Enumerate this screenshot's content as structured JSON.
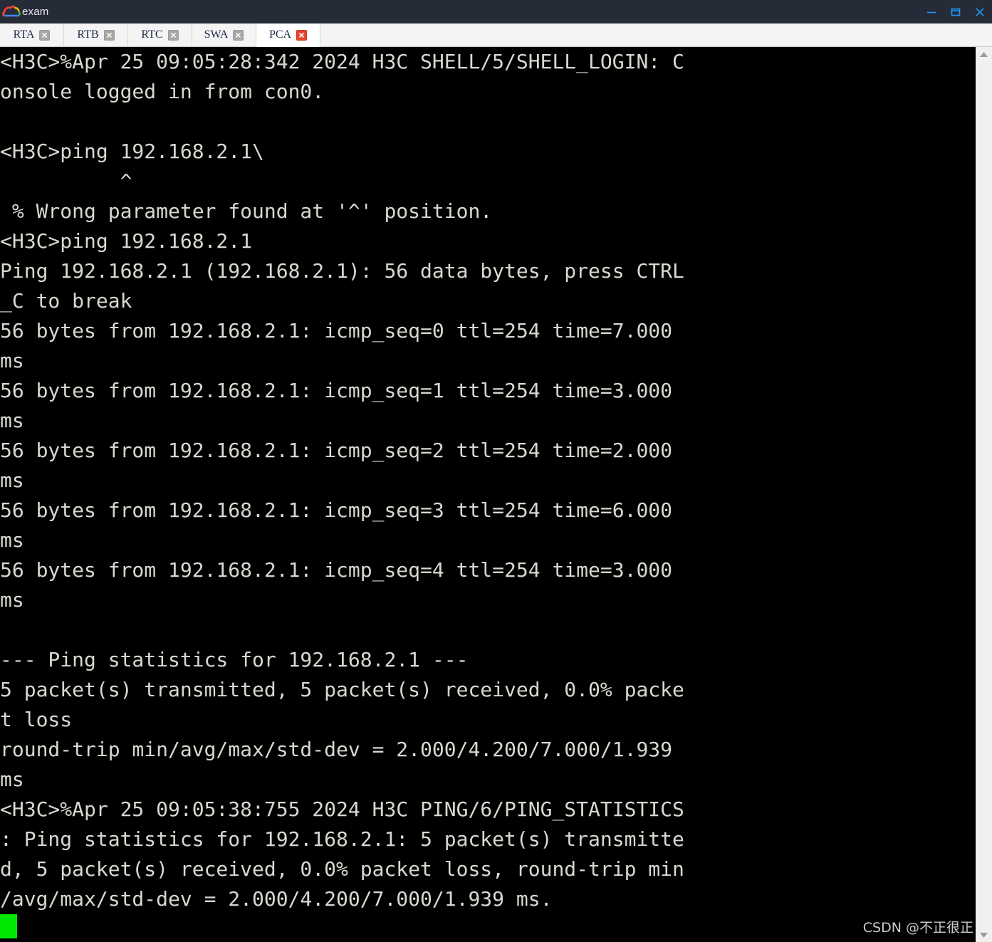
{
  "window": {
    "title": "exam",
    "logo_icon": "cloud-logo-icon",
    "controls": {
      "minimize_label": "minimize-icon",
      "maximize_label": "maximize-icon",
      "close_label": "close-icon"
    }
  },
  "tabs": [
    {
      "label": "RTA",
      "active": false,
      "close_icon": "close-icon"
    },
    {
      "label": "RTB",
      "active": false,
      "close_icon": "close-icon"
    },
    {
      "label": "RTC",
      "active": false,
      "close_icon": "close-icon"
    },
    {
      "label": "SWA",
      "active": false,
      "close_icon": "close-icon"
    },
    {
      "label": "PCA",
      "active": true,
      "close_icon": "close-icon"
    }
  ],
  "terminal": {
    "device_prompt": "<H3C>",
    "target_ip": "192.168.2.1",
    "lines": [
      "<H3C>%Apr 25 09:05:28:342 2024 H3C SHELL/5/SHELL_LOGIN: C",
      "onsole logged in from con0.",
      "",
      "<H3C>ping 192.168.2.1\\",
      "          ^",
      " % Wrong parameter found at '^' position.",
      "<H3C>ping 192.168.2.1",
      "Ping 192.168.2.1 (192.168.2.1): 56 data bytes, press CTRL",
      "_C to break",
      "56 bytes from 192.168.2.1: icmp_seq=0 ttl=254 time=7.000",
      "ms",
      "56 bytes from 192.168.2.1: icmp_seq=1 ttl=254 time=3.000",
      "ms",
      "56 bytes from 192.168.2.1: icmp_seq=2 ttl=254 time=2.000",
      "ms",
      "56 bytes from 192.168.2.1: icmp_seq=3 ttl=254 time=6.000",
      "ms",
      "56 bytes from 192.168.2.1: icmp_seq=4 ttl=254 time=3.000",
      "ms",
      "",
      "--- Ping statistics for 192.168.2.1 ---",
      "5 packet(s) transmitted, 5 packet(s) received, 0.0% packe",
      "t loss",
      "round-trip min/avg/max/std-dev = 2.000/4.200/7.000/1.939",
      "ms",
      "<H3C>%Apr 25 09:05:38:755 2024 H3C PING/6/PING_STATISTICS",
      ": Ping statistics for 192.168.2.1: 5 packet(s) transmitte",
      "d, 5 packet(s) received, 0.0% packet loss, round-trip min",
      "/avg/max/std-dev = 2.000/4.200/7.000/1.939 ms."
    ],
    "cursor": "block-cursor",
    "ping_summary": {
      "packets_transmitted": 5,
      "packets_received": 5,
      "packet_loss": "0.0%",
      "rtt_min": "2.000",
      "rtt_avg": "4.200",
      "rtt_max": "7.000",
      "rtt_stddev": "1.939",
      "units": "ms",
      "replies": [
        {
          "bytes": 56,
          "from": "192.168.2.1",
          "icmp_seq": 0,
          "ttl": 254,
          "time": "7.000"
        },
        {
          "bytes": 56,
          "from": "192.168.2.1",
          "icmp_seq": 1,
          "ttl": 254,
          "time": "3.000"
        },
        {
          "bytes": 56,
          "from": "192.168.2.1",
          "icmp_seq": 2,
          "ttl": 254,
          "time": "2.000"
        },
        {
          "bytes": 56,
          "from": "192.168.2.1",
          "icmp_seq": 3,
          "ttl": 254,
          "time": "6.000"
        },
        {
          "bytes": 56,
          "from": "192.168.2.1",
          "icmp_seq": 4,
          "ttl": 254,
          "time": "3.000"
        }
      ]
    }
  },
  "scrollbar": {
    "up_arrow_icon": "triangle-up-icon",
    "down_arrow_icon": "triangle-down-icon"
  },
  "watermark": {
    "text": "CSDN @不正很正"
  },
  "colors": {
    "titlebar_bg": "#262b38",
    "tabbar_bg": "#f4f4f4",
    "active_tab_bg": "#ffffff",
    "terminal_bg": "#000000",
    "terminal_fg": "#d8d8d0",
    "cursor": "#00e800",
    "close_active": "#e8452c",
    "win_control": "#2196f3"
  }
}
